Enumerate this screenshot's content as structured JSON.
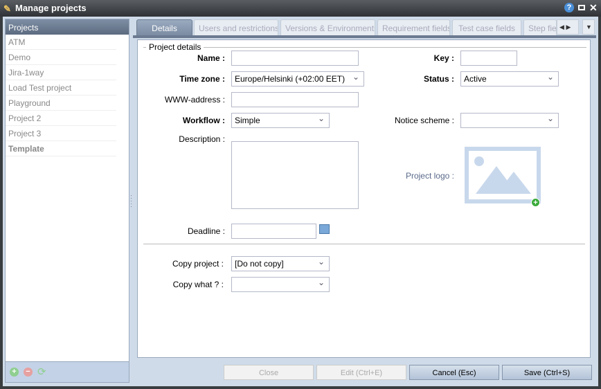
{
  "window": {
    "title": "Manage projects",
    "help_icon": "help-icon",
    "maximize_icon": "maximize-icon",
    "close_icon": "close-icon"
  },
  "sidebar": {
    "header": "Projects",
    "items": [
      {
        "label": "ATM"
      },
      {
        "label": "Demo"
      },
      {
        "label": "Jira-1way"
      },
      {
        "label": "Load Test project"
      },
      {
        "label": "Playground"
      },
      {
        "label": "Project 2"
      },
      {
        "label": "Project 3"
      },
      {
        "label": "Template",
        "bold": true
      }
    ]
  },
  "tabs": [
    {
      "label": "Details",
      "active": true
    },
    {
      "label": "Users and restrictions"
    },
    {
      "label": "Versions & Environments"
    },
    {
      "label": "Requirement fields"
    },
    {
      "label": "Test case fields"
    },
    {
      "label": "Step fie"
    }
  ],
  "form": {
    "legend": "Project details",
    "name": {
      "label": "Name :",
      "value": ""
    },
    "key": {
      "label": "Key :",
      "value": ""
    },
    "timezone": {
      "label": "Time zone :",
      "value": "Europe/Helsinki (+02:00 EET)"
    },
    "status": {
      "label": "Status :",
      "value": "Active"
    },
    "www": {
      "label": "WWW-address :",
      "value": ""
    },
    "workflow": {
      "label": "Workflow :",
      "value": "Simple"
    },
    "notice": {
      "label": "Notice scheme :",
      "value": ""
    },
    "description": {
      "label": "Description :",
      "value": ""
    },
    "logo": {
      "label": "Project logo :"
    },
    "deadline": {
      "label": "Deadline :",
      "value": ""
    },
    "copy_project": {
      "label": "Copy project :",
      "value": "[Do not copy]"
    },
    "copy_what": {
      "label": "Copy what ? :",
      "value": ""
    }
  },
  "buttons": {
    "close": "Close",
    "edit": "Edit (Ctrl+E)",
    "cancel": "Cancel (Esc)",
    "save": "Save (Ctrl+S)"
  }
}
